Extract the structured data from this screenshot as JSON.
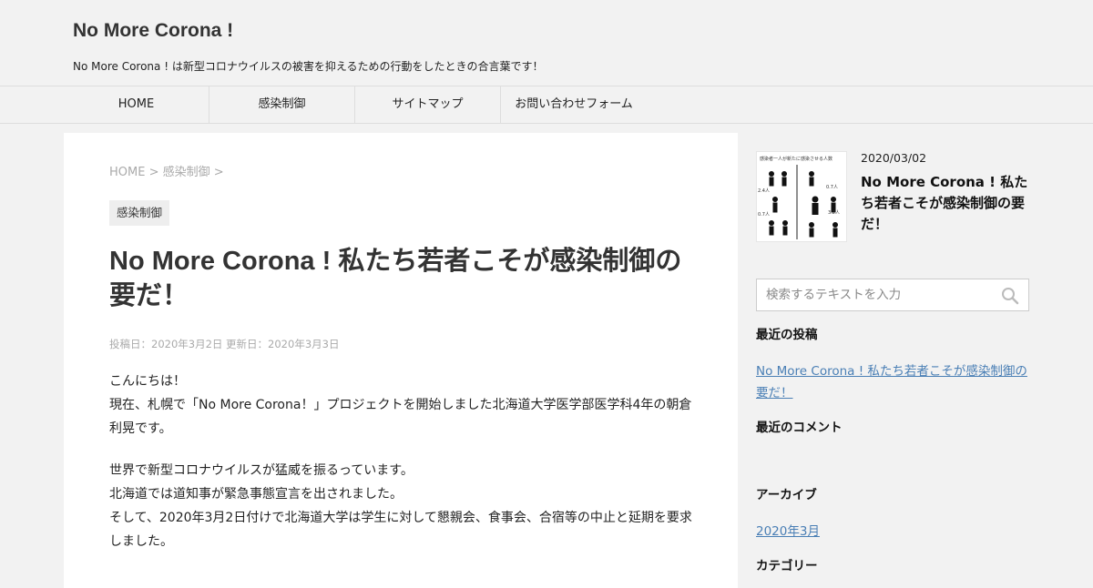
{
  "site": {
    "title": "No More Corona !",
    "description": "No More Corona ! は新型コロナウイルスの被害を抑えるための行動をしたときの合言葉です！"
  },
  "nav": {
    "items": [
      {
        "label": "HOME"
      },
      {
        "label": "感染制御"
      },
      {
        "label": "サイトマップ"
      },
      {
        "label": "お問い合わせフォーム"
      }
    ]
  },
  "breadcrumb": {
    "home": "HOME",
    "sep1": " > ",
    "category": "感染制御",
    "sep2": " >"
  },
  "post": {
    "category": "感染制御",
    "title": "No More Corona ! 私たち若者こそが感染制御の要だ！",
    "meta": "投稿日：2020年3月2日 更新日：2020年3月3日",
    "paragraphs": [
      {
        "lines": [
          "こんにちは！",
          "現在、札幌で「No More Corona！」プロジェクトを開始しました北海道大学医学部医学科4年の朝倉利晃です。"
        ]
      },
      {
        "lines": [
          "世界で新型コロナウイルスが猛威を振るっています。",
          "北海道では道知事が緊急事態宣言を出されました。",
          "そして、2020年3月2日付けで北海道大学は学生に対して懇親会、食事会、合宿等の中止と延期を要求しました。"
        ]
      }
    ]
  },
  "sidebar": {
    "featured": {
      "date": "2020/03/02",
      "title": "No More Corona ! 私たち若者こそが感染制御の要だ！",
      "thumb_caption": "感染者一人が新たに感染させる人数",
      "thumb_labels": [
        "2.4人",
        "0.7人",
        "0.7人",
        "3.2人"
      ]
    },
    "search": {
      "placeholder": "検索するテキストを入力"
    },
    "recent_posts": {
      "heading": "最近の投稿",
      "items": [
        {
          "label": "No More Corona ! 私たち若者こそが感染制御の要だ！"
        }
      ]
    },
    "recent_comments": {
      "heading": "最近のコメント"
    },
    "archives": {
      "heading": "アーカイブ",
      "items": [
        {
          "label": "2020年3月"
        }
      ]
    },
    "categories": {
      "heading": "カテゴリー"
    }
  }
}
